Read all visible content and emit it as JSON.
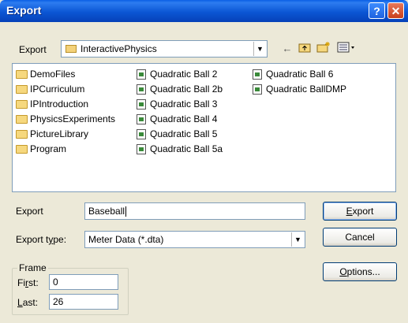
{
  "window": {
    "title": "Export",
    "help_label": "?",
    "close_label": "✕"
  },
  "location": {
    "label": "Export",
    "folder": "InteractivePhysics",
    "tools": [
      "back-arrow-icon",
      "up-folder-icon",
      "new-folder-icon",
      "view-menu-icon"
    ]
  },
  "files": {
    "col1": [
      "DemoFiles",
      "IPCurriculum",
      "IPIntroduction",
      "PhysicsExperiments",
      "PictureLibrary",
      "Program"
    ],
    "col2": [
      "Quadratic Ball 2",
      "Quadratic Ball 2b",
      "Quadratic Ball 3",
      "Quadratic Ball 4",
      "Quadratic Ball 5",
      "Quadratic Ball 5a"
    ],
    "col3": [
      "Quadratic Ball 6",
      "Quadratic BallDMP"
    ]
  },
  "filename": {
    "label": "Export",
    "value": "Baseball"
  },
  "type": {
    "label_pre": "Export t",
    "label_u": "y",
    "label_post": "pe:",
    "value": "Meter Data (*.dta)"
  },
  "buttons": {
    "export_u": "E",
    "export_rest": "xport",
    "cancel": "Cancel",
    "options_u": "O",
    "options_rest": "ptions..."
  },
  "frame": {
    "legend": "Frame",
    "first_pre": "Fi",
    "first_u": "r",
    "first_post": "st:",
    "first_value": "0",
    "last_u": "L",
    "last_post": "ast:",
    "last_value": "26"
  }
}
